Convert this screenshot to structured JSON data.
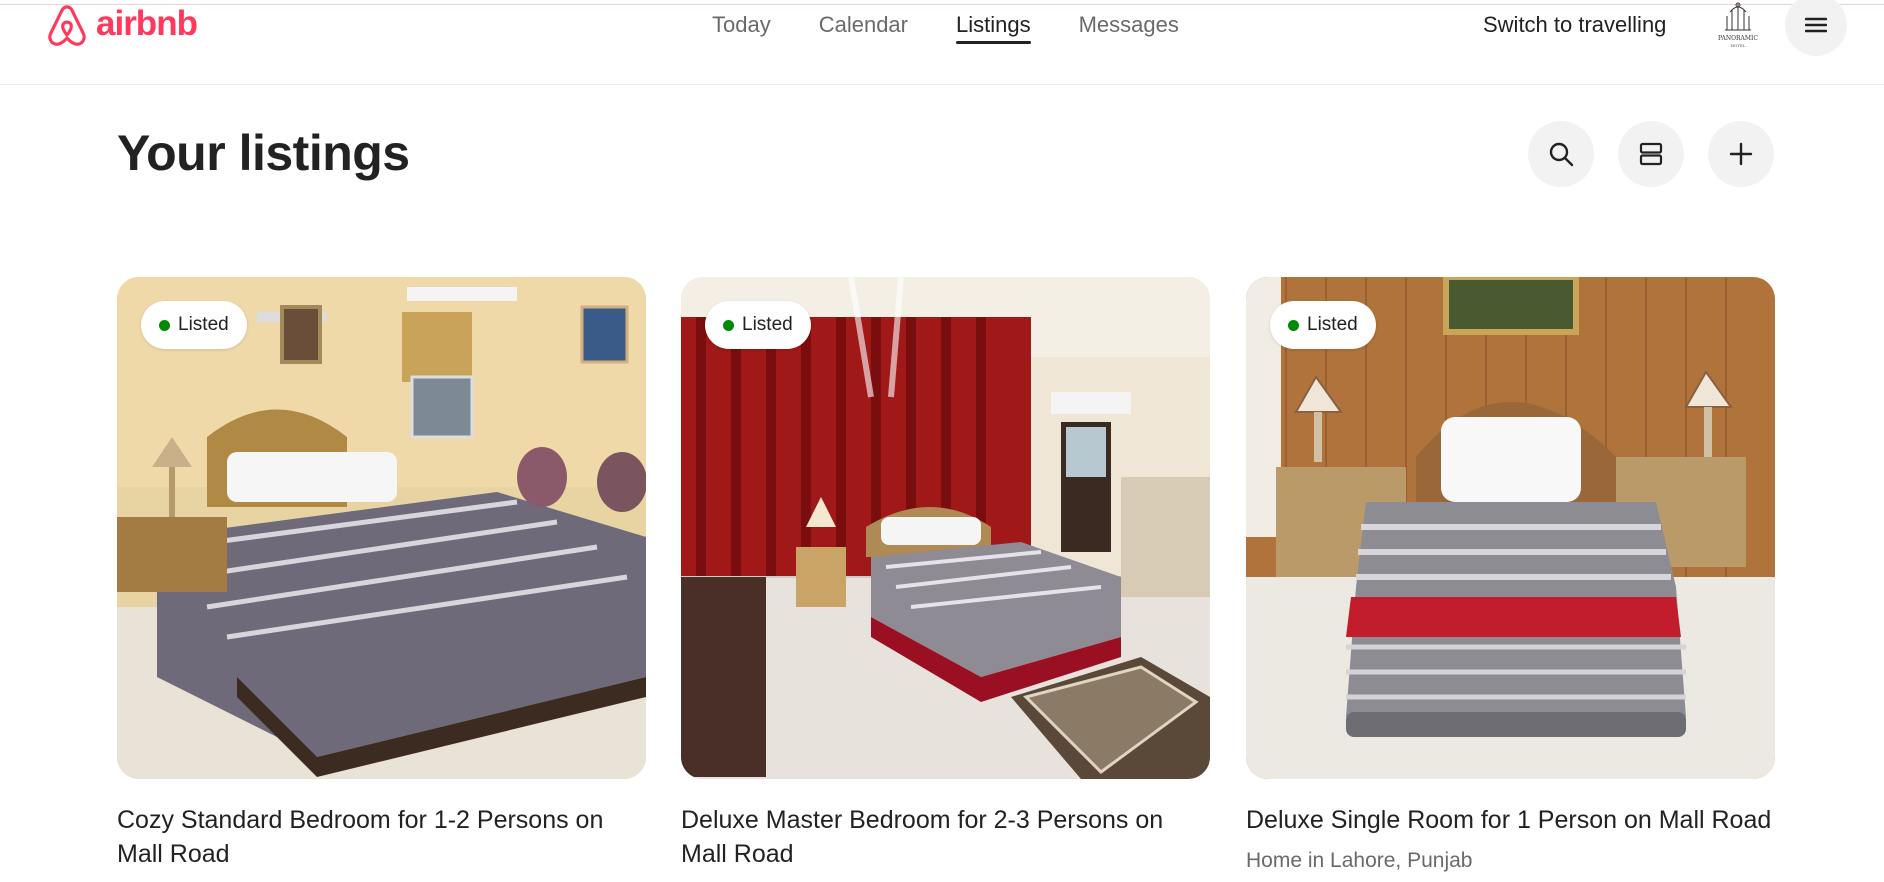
{
  "header": {
    "logo_text": "airbnb",
    "nav": [
      {
        "label": "Today"
      },
      {
        "label": "Calendar"
      },
      {
        "label": "Listings",
        "active": true
      },
      {
        "label": "Messages"
      }
    ],
    "switch_label": "Switch to travelling",
    "avatar_text": "PANORAMIC",
    "avatar_subtext": "HOTEL"
  },
  "main": {
    "title": "Your listings",
    "actions": [
      {
        "icon": "search-icon"
      },
      {
        "icon": "list-view-icon"
      },
      {
        "icon": "plus-icon"
      }
    ],
    "listings": [
      {
        "status": "Listed",
        "title": "Cozy Standard Bedroom for 1-2 Persons on Mall Road",
        "subtitle": ""
      },
      {
        "status": "Listed",
        "title": "Deluxe Master Bedroom for 2-3 Persons on Mall Road",
        "subtitle": ""
      },
      {
        "status": "Listed",
        "title": "Deluxe Single Room for 1 Person on Mall Road",
        "subtitle": "Home in Lahore, Punjab"
      }
    ]
  },
  "colors": {
    "brand": "#ff385c",
    "status_listed": "#008a05",
    "text": "#222222",
    "muted": "#6a6a6a"
  }
}
